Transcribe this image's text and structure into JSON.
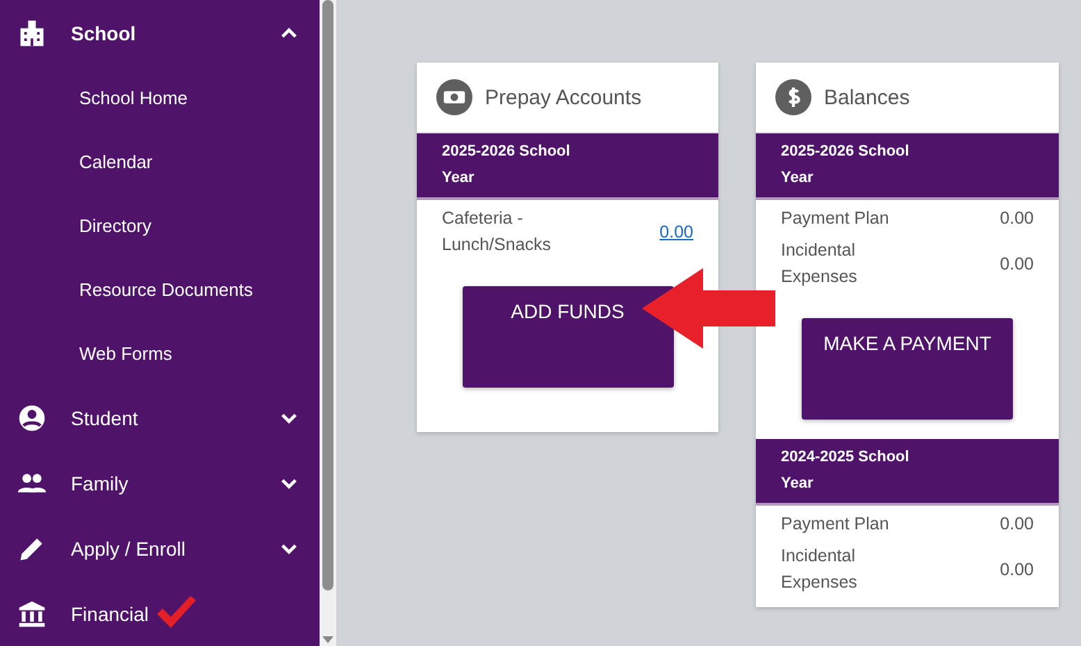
{
  "sidebar": {
    "items": [
      {
        "label": "School",
        "expanded": true,
        "children": [
          {
            "label": "School Home"
          },
          {
            "label": "Calendar"
          },
          {
            "label": "Directory"
          },
          {
            "label": "Resource Documents"
          },
          {
            "label": "Web Forms"
          }
        ]
      },
      {
        "label": "Student",
        "expanded": false
      },
      {
        "label": "Family",
        "expanded": false
      },
      {
        "label": "Apply / Enroll",
        "expanded": false
      },
      {
        "label": "Financial"
      }
    ]
  },
  "cards": [
    {
      "title": "Prepay Accounts",
      "sections": [
        {
          "heading": "2025-2026 School Year",
          "rows": [
            {
              "label": "Cafeteria - Lunch/Snacks",
              "value": "0.00",
              "link": true
            }
          ],
          "button": "ADD FUNDS"
        }
      ]
    },
    {
      "title": "Balances",
      "sections": [
        {
          "heading": "2025-2026 School Year",
          "rows": [
            {
              "label": "Payment Plan",
              "value": "0.00",
              "link": false
            },
            {
              "label": "Incidental Expenses",
              "value": "0.00",
              "link": false
            }
          ],
          "button": "MAKE A PAYMENT"
        },
        {
          "heading": "2024-2025 School Year",
          "rows": [
            {
              "label": "Payment Plan",
              "value": "0.00",
              "link": false
            },
            {
              "label": "Incidental Expenses",
              "value": "0.00",
              "link": false
            }
          ]
        }
      ]
    }
  ]
}
